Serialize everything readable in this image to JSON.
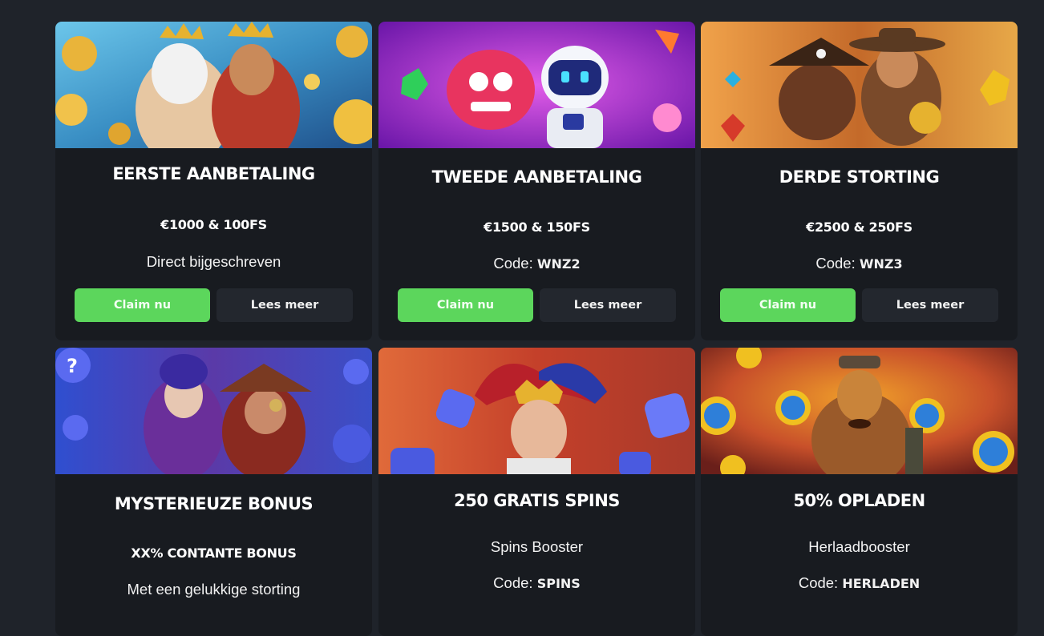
{
  "cards": [
    {
      "title": "EERSTE AANBETALING",
      "amount": "€1000 & 100FS",
      "subtitle": "Direct bijgeschreven",
      "claim_label": "Claim nu",
      "read_label": "Lees meer",
      "banner_colors": [
        "#4fb0d8",
        "#e9b43a",
        "#c0392b"
      ]
    },
    {
      "title": "TWEEDE AANBETALING",
      "amount": "€1500 & 150FS",
      "code_prefix": "Code: ",
      "code": "WNZ2",
      "claim_label": "Claim nu",
      "read_label": "Lees meer",
      "banner_colors": [
        "#c23fd0",
        "#7a1fb2",
        "#ff4f7a"
      ]
    },
    {
      "title": "DERDE STORTING",
      "amount": "€2500 & 250FS",
      "code_prefix": "Code: ",
      "code": "WNZ3",
      "claim_label": "Claim nu",
      "read_label": "Lees meer",
      "banner_colors": [
        "#d9893b",
        "#5a3a22",
        "#e0b04a"
      ]
    },
    {
      "title": "MYSTERIEUZE BONUS",
      "amount": "XX% CONTANTE BONUS",
      "subtitle": "Met een gelukkige storting",
      "banner_colors": [
        "#3a56c9",
        "#6f3fb0",
        "#8b3a2a"
      ]
    },
    {
      "title": "250 GRATIS SPINS",
      "subtitle": "Spins Booster",
      "code_prefix": "Code: ",
      "code": "SPINS",
      "banner_colors": [
        "#d45a3a",
        "#3b3fb4",
        "#e8b13b"
      ]
    },
    {
      "title": "50% OPLADEN",
      "subtitle": "Herlaadbooster",
      "code_prefix": "Code: ",
      "code": "HERLADEN",
      "banner_colors": [
        "#e06a2a",
        "#8a2a1a",
        "#2e7fd9"
      ]
    }
  ],
  "colors": {
    "page_bg": "#1f232a",
    "card_bg": "#181b20",
    "claim_button": "#5cd65c",
    "read_button": "#23272e"
  }
}
